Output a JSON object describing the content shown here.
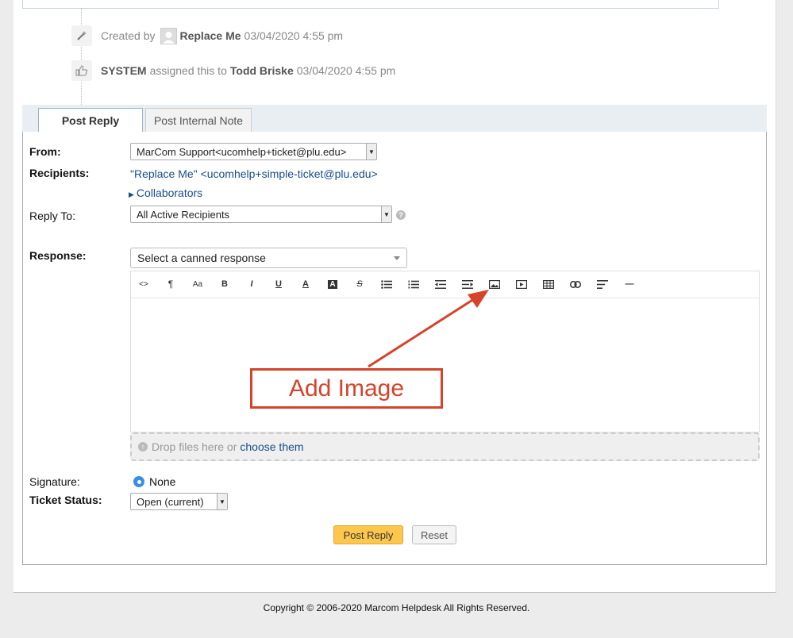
{
  "thread": {
    "created": {
      "prefix": "Created by",
      "user": "Replace Me",
      "date": "03/04/2020 4:55 pm"
    },
    "assigned": {
      "actor": "SYSTEM",
      "text": "assigned this to",
      "assignee": "Todd Briske",
      "date": "03/04/2020 4:55 pm"
    }
  },
  "tabs": [
    {
      "label": "Post Reply",
      "active": true
    },
    {
      "label": "Post Internal Note",
      "active": false
    }
  ],
  "form": {
    "from_label": "From:",
    "from_value": "MarCom Support<ucomhelp+ticket@plu.edu>",
    "recipients_label": "Recipients:",
    "recipients_value": "\"Replace Me\" <ucomhelp+simple-ticket@plu.edu>",
    "collaborators_label": "Collaborators",
    "reply_to_label": "Reply To:",
    "reply_to_value": "All Active Recipients",
    "response_label": "Response:",
    "canned_placeholder": "Select a canned response",
    "dropzone_text": "Drop files here or",
    "dropzone_link": "choose them",
    "signature_label": "Signature:",
    "signature_value": "None",
    "status_label": "Ticket Status:",
    "status_value": "Open (current)",
    "post_button": "Post Reply",
    "reset_button": "Reset"
  },
  "toolbar": {
    "buttons": [
      "code-view",
      "paragraph",
      "font-size",
      "bold",
      "italic",
      "underline",
      "font-color",
      "background-color",
      "strikethrough",
      "unordered-list",
      "ordered-list",
      "outdent",
      "indent",
      "image",
      "video",
      "table",
      "link",
      "align",
      "horizontal-rule"
    ],
    "glyphs": {
      "code": "<>",
      "paragraph": "¶",
      "font_size": "Aa",
      "bold": "B",
      "italic": "I",
      "underline": "U",
      "font_color": "A",
      "background_color": "A",
      "strikethrough": "S",
      "rule": "—"
    }
  },
  "annotation": {
    "label": "Add Image",
    "color": "#d5432a"
  },
  "footer": {
    "text": "Copyright © 2006-2020 Marcom Helpdesk All Rights Reserved."
  },
  "colors": {
    "accent": "#fdc74e",
    "link": "#184e87",
    "radio": "#3a8ee6"
  }
}
